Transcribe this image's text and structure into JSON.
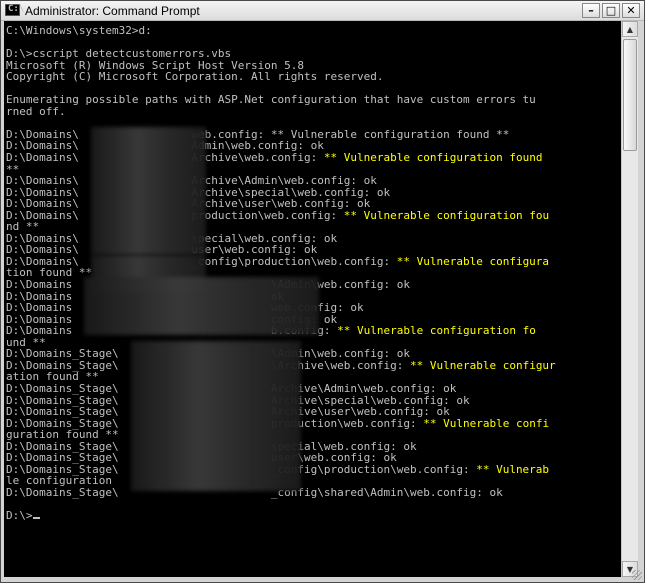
{
  "window": {
    "title": "Administrator: Command Prompt",
    "icon": "cmd-app-icon",
    "buttons": {
      "minimize": "–",
      "maximize": "□",
      "close": "✕"
    }
  },
  "colors": {
    "console_bg": "#000000",
    "text": "#c0c0c0",
    "highlight": "#ffff00"
  },
  "console": {
    "lines": [
      [
        {
          "t": "C:\\Windows\\system32>d:"
        }
      ],
      [
        {
          "t": ""
        }
      ],
      [
        {
          "t": "D:\\>cscript detectcustomerrors.vbs"
        }
      ],
      [
        {
          "t": "Microsoft (R) Windows Script Host Version 5.8"
        }
      ],
      [
        {
          "t": "Copyright (C) Microsoft Corporation. All rights reserved."
        }
      ],
      [
        {
          "t": ""
        }
      ],
      [
        {
          "t": "Enumerating possible paths with ASP.Net configuration that have custom errors tu"
        }
      ],
      [
        {
          "t": "rned off."
        }
      ],
      [
        {
          "t": ""
        }
      ],
      [
        {
          "t": "D:\\Domains\\                 web.config: ** Vulnerable configuration found **"
        }
      ],
      [
        {
          "t": "D:\\Domains\\                 Admin\\web.config: ok"
        }
      ],
      [
        {
          "t": "D:\\Domains\\                 Archive\\web.config: "
        },
        {
          "t": "** Vulnerable configuration found",
          "y": true
        }
      ],
      [
        {
          "t": "**"
        }
      ],
      [
        {
          "t": "D:\\Domains\\                 Archive\\Admin\\web.config: ok"
        }
      ],
      [
        {
          "t": "D:\\Domains\\                 Archive\\special\\web.config: ok"
        }
      ],
      [
        {
          "t": "D:\\Domains\\                 Archive\\user\\web.config: ok"
        }
      ],
      [
        {
          "t": "D:\\Domains\\                 production\\web.config: "
        },
        {
          "t": "** Vulnerable configuration fou",
          "y": true
        }
      ],
      [
        {
          "t": "nd **"
        }
      ],
      [
        {
          "t": "D:\\Domains\\                 special\\web.config: ok"
        }
      ],
      [
        {
          "t": "D:\\Domains\\                 user\\web.config: ok"
        }
      ],
      [
        {
          "t": "D:\\Domains\\                 _config\\production\\web.config: "
        },
        {
          "t": "** Vulnerable configura",
          "y": true
        }
      ],
      [
        {
          "t": "tion found **"
        }
      ],
      [
        {
          "t": "D:\\Domains                              \\Admin\\web.config: ok"
        }
      ],
      [
        {
          "t": "D:\\Domains                              ok"
        }
      ],
      [
        {
          "t": "D:\\Domains                              web.config: ok"
        }
      ],
      [
        {
          "t": "D:\\Domains                              config: ok"
        }
      ],
      [
        {
          "t": "D:\\Domains                              b.config: "
        },
        {
          "t": "** Vulnerable configuration fo",
          "y": true
        }
      ],
      [
        {
          "t": "und **"
        }
      ],
      [
        {
          "t": "D:\\Domains_Stage\\                       \\Admin\\web.config: ok"
        }
      ],
      [
        {
          "t": "D:\\Domains_Stage\\                       \\Archive\\web.config: "
        },
        {
          "t": "** Vulnerable configur",
          "y": true
        }
      ],
      [
        {
          "t": "ation found **"
        }
      ],
      [
        {
          "t": "D:\\Domains_Stage\\                       Archive\\Admin\\web.config: ok"
        }
      ],
      [
        {
          "t": "D:\\Domains_Stage\\                       Archive\\special\\web.config: ok"
        }
      ],
      [
        {
          "t": "D:\\Domains_Stage\\                       Archive\\user\\web.config: ok"
        }
      ],
      [
        {
          "t": "D:\\Domains_Stage\\                       production\\web.config: "
        },
        {
          "t": "** Vulnerable confi",
          "y": true
        }
      ],
      [
        {
          "t": "guration found **"
        }
      ],
      [
        {
          "t": "D:\\Domains_Stage\\                       special\\web.config: ok"
        }
      ],
      [
        {
          "t": "D:\\Domains_Stage\\                       user\\web.config: ok"
        }
      ],
      [
        {
          "t": "D:\\Domains_Stage\\                       _config\\production\\web.config: "
        },
        {
          "t": "** Vulnerab",
          "y": true
        }
      ],
      [
        {
          "t": "le configuration"
        }
      ],
      [
        {
          "t": "D:\\Domains_Stage\\                       _config\\shared\\Admin\\web.config: ok"
        }
      ],
      [
        {
          "t": ""
        }
      ],
      [
        {
          "t": "D:\\>",
          "cursor": true
        }
      ]
    ]
  },
  "scrollbar": {
    "up_icon": "▲",
    "down_icon": "▼"
  }
}
